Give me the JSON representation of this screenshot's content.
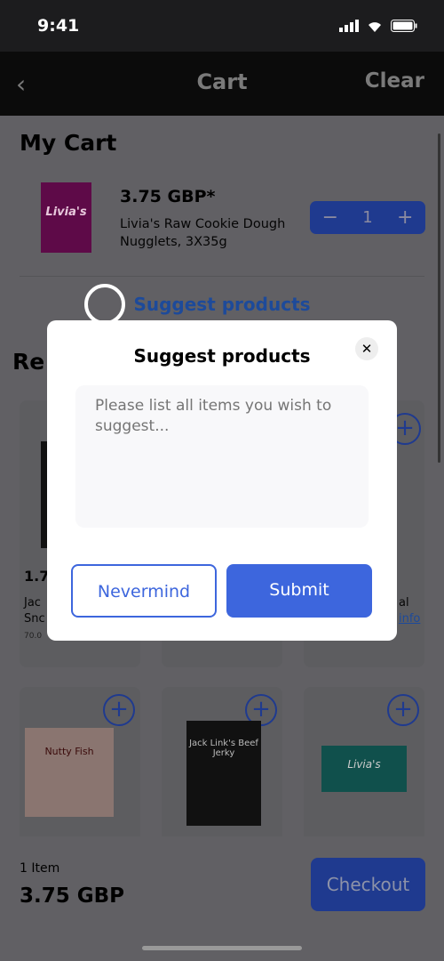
{
  "status_bar": {
    "time": "9:41"
  },
  "header": {
    "back_icon": "chevron-left-icon",
    "title": "Cart",
    "clear_label": "Clear"
  },
  "cart": {
    "heading": "My Cart",
    "item": {
      "price": "3.75 GBP*",
      "name_line1": "Livia's Raw Cookie Dough",
      "name_line2": "Nugglets, 3X35g",
      "image_label": "Livia's",
      "quantity": "1"
    },
    "suggest_link": "Suggest products"
  },
  "recommended": {
    "heading_partial": "Re",
    "cards_row1": [
      {
        "price_partial": "1.7",
        "name_partial_1": "Jac",
        "name_partial_2": "Snc",
        "weight_partial": "70.0"
      },
      {},
      {
        "name_partial": "al",
        "link_partial": "info"
      }
    ],
    "cards_row2": [
      {
        "image_label": "Nutty Fish"
      },
      {
        "image_label": "Jack Link's Beef Jerky"
      },
      {
        "image_label": "Livia's"
      }
    ]
  },
  "footer": {
    "items_count": "1 Item",
    "total": "3.75 GBP",
    "checkout_label": "Checkout"
  },
  "modal": {
    "title": "Suggest products",
    "placeholder": "Please list all items you wish to suggest...",
    "nevermind_label": "Nevermind",
    "submit_label": "Submit",
    "close_icon": "close-icon"
  },
  "colors": {
    "accent": "#3d66dd",
    "dim_accent": "#2f54c9"
  }
}
